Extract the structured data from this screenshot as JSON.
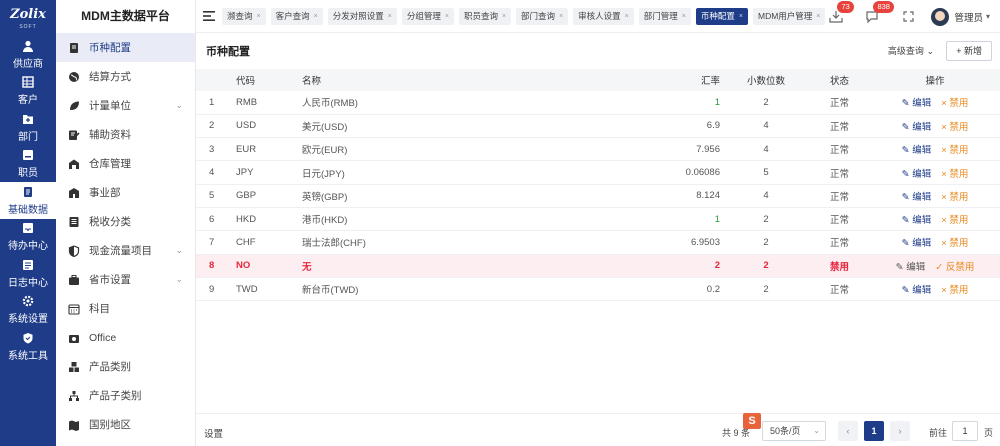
{
  "brand": {
    "logo": "Zolix",
    "logo_sub": "SOFT",
    "platform_title": "MDM主数据平台"
  },
  "nav": [
    {
      "label": "供应商",
      "icon": "user-icon"
    },
    {
      "label": "客户",
      "icon": "grid-icon"
    },
    {
      "label": "部门",
      "icon": "folder-plus-icon"
    },
    {
      "label": "职员",
      "icon": "id-card-icon"
    },
    {
      "label": "基础数据",
      "icon": "document-icon",
      "active": true
    },
    {
      "label": "待办中心",
      "icon": "inbox-icon"
    },
    {
      "label": "日志中心",
      "icon": "log-icon"
    },
    {
      "label": "系统设置",
      "icon": "gear-icon"
    },
    {
      "label": "系统工具",
      "icon": "shield-icon"
    }
  ],
  "submenu": [
    {
      "label": "币种配置",
      "icon": "book-icon",
      "active": true
    },
    {
      "label": "结算方式",
      "icon": "globe-icon"
    },
    {
      "label": "计量单位",
      "icon": "leaf-icon",
      "expandable": true
    },
    {
      "label": "辅助资料",
      "icon": "edit-icon"
    },
    {
      "label": "仓库管理",
      "icon": "warehouse-icon"
    },
    {
      "label": "事业部",
      "icon": "building-icon"
    },
    {
      "label": "税收分类",
      "icon": "tax-icon"
    },
    {
      "label": "现金流量项目",
      "icon": "shield-half-icon",
      "expandable": true
    },
    {
      "label": "省市设置",
      "icon": "briefcase-icon",
      "expandable": true
    },
    {
      "label": "科目",
      "icon": "calendar-icon"
    },
    {
      "label": "Office",
      "icon": "camera-icon"
    },
    {
      "label": "产品类别",
      "icon": "boxes-icon"
    },
    {
      "label": "产品子类别",
      "icon": "hierarchy-icon"
    },
    {
      "label": "国别地区",
      "icon": "map-icon"
    }
  ],
  "tabs": [
    {
      "label": "濒查询"
    },
    {
      "label": "客户查询"
    },
    {
      "label": "分发对照设置"
    },
    {
      "label": "分组管理"
    },
    {
      "label": "职员查询"
    },
    {
      "label": "部门查询"
    },
    {
      "label": "审核人设置"
    },
    {
      "label": "部门管理"
    },
    {
      "label": "币种配置",
      "active": true
    },
    {
      "label": "MDM用户管理"
    }
  ],
  "top_right": {
    "badge_tasks": "73",
    "badge_messages": "838",
    "user_name": "管理员"
  },
  "panel": {
    "title": "币种配置",
    "advanced_search": "高级查询",
    "new_button": "新增"
  },
  "table": {
    "headers": {
      "code": "代码",
      "name": "名称",
      "rate": "汇率",
      "decimals": "小数位数",
      "status": "状态",
      "ops": "操作"
    },
    "edit_label": "编辑",
    "rows": [
      {
        "idx": "1",
        "code": "RMB",
        "name": "人民币(RMB)",
        "rate": "1",
        "decimals": "2",
        "status": "正常",
        "action": "禁用"
      },
      {
        "idx": "2",
        "code": "USD",
        "name": "美元(USD)",
        "rate": "6.9",
        "decimals": "4",
        "status": "正常",
        "action": "禁用"
      },
      {
        "idx": "3",
        "code": "EUR",
        "name": "欧元(EUR)",
        "rate": "7.956",
        "decimals": "4",
        "status": "正常",
        "action": "禁用"
      },
      {
        "idx": "4",
        "code": "JPY",
        "name": "日元(JPY)",
        "rate": "0.06086",
        "decimals": "5",
        "status": "正常",
        "action": "禁用"
      },
      {
        "idx": "5",
        "code": "GBP",
        "name": "英镑(GBP)",
        "rate": "8.124",
        "decimals": "4",
        "status": "正常",
        "action": "禁用"
      },
      {
        "idx": "6",
        "code": "HKD",
        "name": "港币(HKD)",
        "rate": "1",
        "decimals": "2",
        "status": "正常",
        "action": "禁用"
      },
      {
        "idx": "7",
        "code": "CHF",
        "name": "瑞士法郎(CHF)",
        "rate": "6.9503",
        "decimals": "2",
        "status": "正常",
        "action": "禁用"
      },
      {
        "idx": "8",
        "code": "NO",
        "name": "无",
        "rate": "2",
        "decimals": "2",
        "status": "禁用",
        "action": "反禁用",
        "disabled": true
      },
      {
        "idx": "9",
        "code": "TWD",
        "name": "新台币(TWD)",
        "rate": "0.2",
        "decimals": "2",
        "status": "正常",
        "action": "禁用"
      }
    ]
  },
  "footer": {
    "settings": "设置",
    "total": "共 9 条",
    "page_size": "50条/页",
    "current_page": "1",
    "goto_label": "前往",
    "goto_value": "1",
    "goto_suffix": "页"
  },
  "colors": {
    "primary": "#1f3c88",
    "danger": "#e8253c",
    "warning": "#e8891f",
    "success": "#2a9d3c"
  }
}
